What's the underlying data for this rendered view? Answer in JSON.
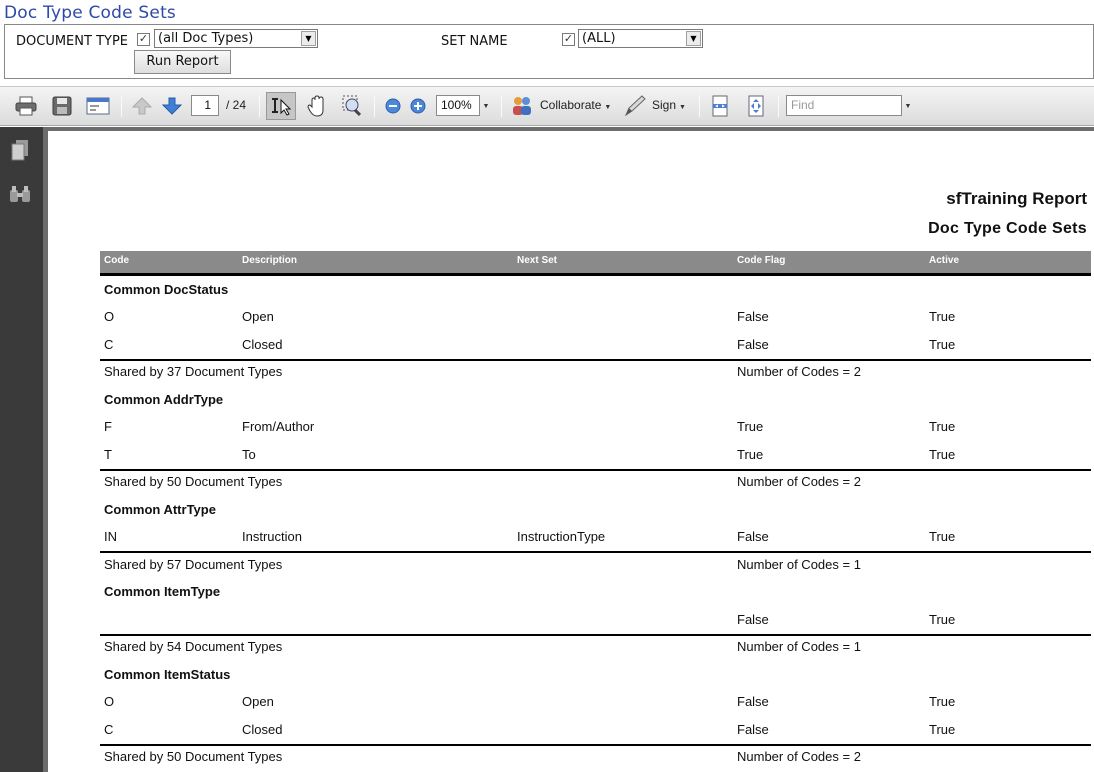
{
  "header": {
    "title": "Doc Type Code Sets"
  },
  "params": {
    "document_type_label": "DOCUMENT TYPE",
    "document_type_checked": "✓",
    "document_type_value": "(all Doc Types)",
    "set_name_label": "SET NAME",
    "set_name_checked": "✓",
    "set_name_value": "(ALL)",
    "run_label": "Run Report"
  },
  "toolbar": {
    "page_current": "1",
    "page_total": "/ 24",
    "zoom": "100%",
    "collaborate_label": "Collaborate",
    "sign_label": "Sign",
    "find_placeholder": "Find"
  },
  "report": {
    "title": "sfTraining Report",
    "subtitle": "Doc Type Code Sets",
    "columns": [
      "Code",
      "Description",
      "Next Set",
      "Code Flag",
      "Active"
    ],
    "groups": [
      {
        "name": "Common  DocStatus",
        "rows": [
          [
            "O",
            "Open",
            "",
            "False",
            "True"
          ],
          [
            "C",
            "Closed",
            "",
            "False",
            "True"
          ]
        ],
        "footer_shared": "Shared by 37 Document Types",
        "footer_count": "Number of Codes = 2"
      },
      {
        "name": "Common  AddrType",
        "rows": [
          [
            "F",
            "From/Author",
            "",
            "True",
            "True"
          ],
          [
            "T",
            "To",
            "",
            "True",
            "True"
          ]
        ],
        "footer_shared": "Shared by 50 Document Types",
        "footer_count": "Number of Codes = 2"
      },
      {
        "name": "Common  AttrType",
        "rows": [
          [
            "IN",
            "Instruction",
            "InstructionType",
            "False",
            "True"
          ]
        ],
        "footer_shared": "Shared by 57 Document Types",
        "footer_count": "Number of Codes = 1"
      },
      {
        "name": "Common  ItemType",
        "rows": [
          [
            "",
            "",
            "",
            "False",
            "True"
          ]
        ],
        "footer_shared": "Shared by 54 Document Types",
        "footer_count": "Number of Codes = 1"
      },
      {
        "name": "Common  ItemStatus",
        "rows": [
          [
            "O",
            "Open",
            "",
            "False",
            "True"
          ],
          [
            "C",
            "Closed",
            "",
            "False",
            "True"
          ]
        ],
        "footer_shared": "Shared by 50 Document Types",
        "footer_count": "Number of Codes = 2"
      }
    ]
  },
  "colors": {
    "title_blue": "#2e4aa8",
    "header_gray": "#8a8a8a",
    "rail_dark": "#3a3a3a"
  },
  "icons": [
    "print-icon",
    "save-icon",
    "email-icon",
    "prev-page-icon",
    "next-page-icon",
    "select-tool-icon",
    "hand-tool-icon",
    "marquee-zoom-icon",
    "zoom-out-icon",
    "zoom-in-icon",
    "collaborate-icon",
    "sign-icon",
    "fit-width-icon",
    "fit-page-icon",
    "pages-icon",
    "attachments-icon"
  ]
}
